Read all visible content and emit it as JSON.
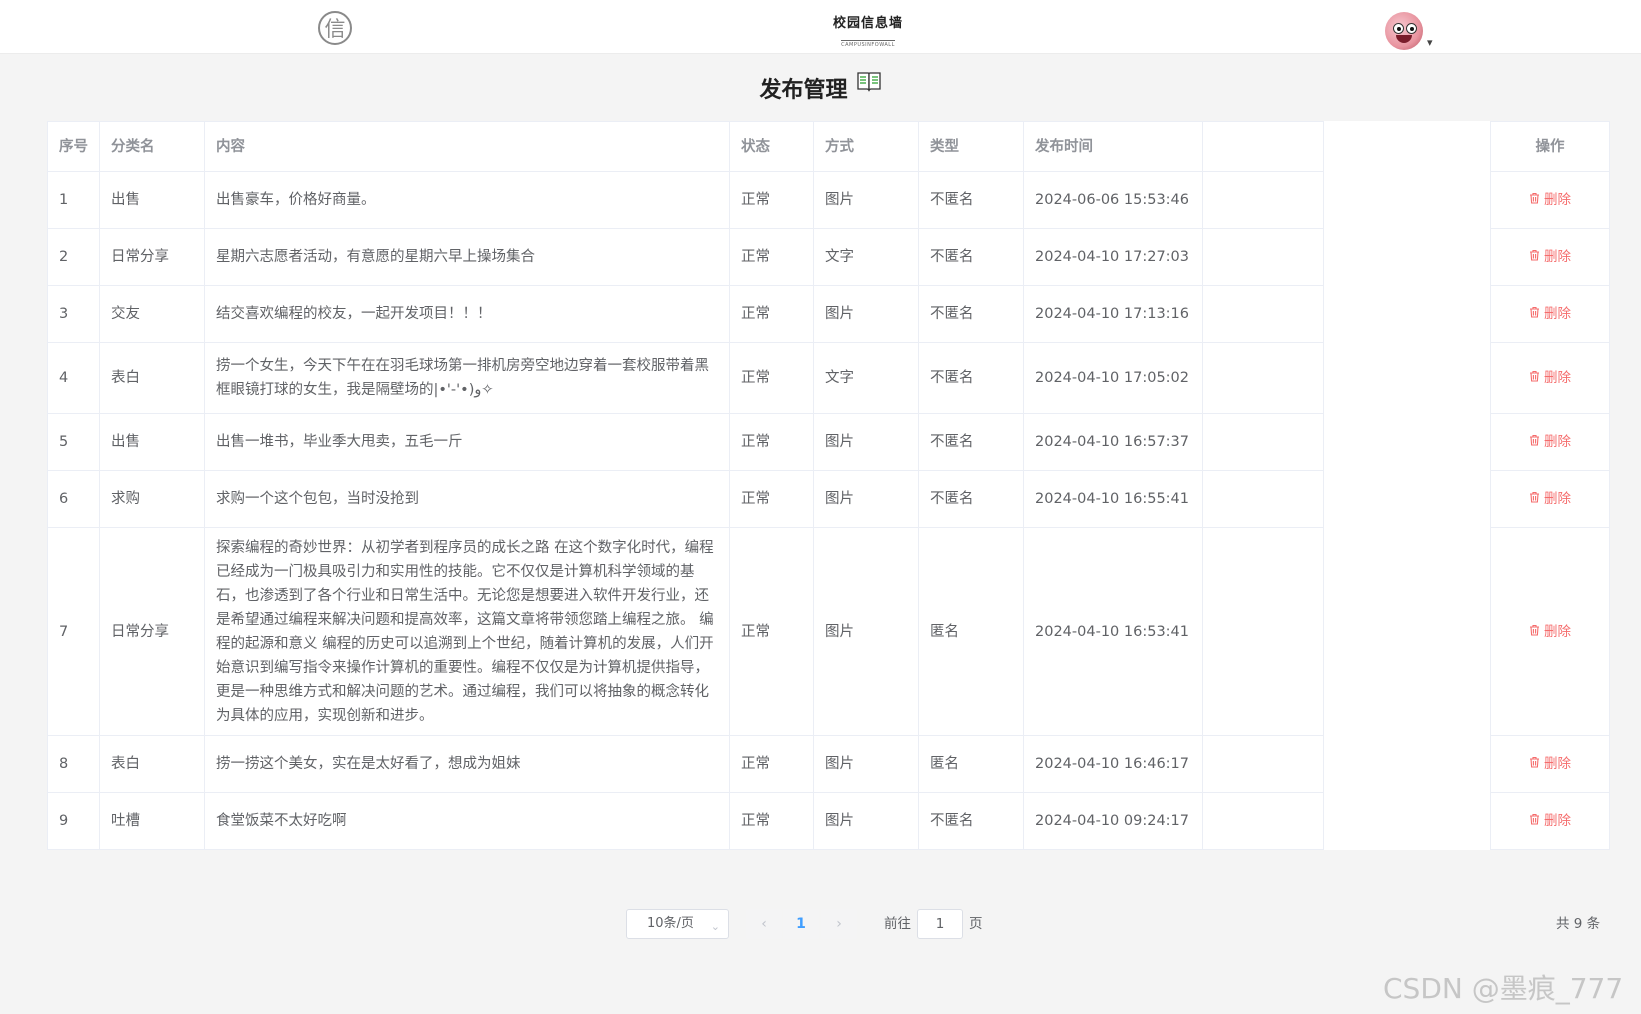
{
  "header": {
    "logo_glyph": "信",
    "brand_title": "校园信息墙",
    "brand_subtitle": "CAMPUSINFOWALL",
    "avatar_icon": "pig-avatar-icon",
    "user_menu_caret": "▾"
  },
  "page": {
    "title": "发布管理",
    "title_icon": "open-book-icon"
  },
  "table": {
    "columns": {
      "index": "序号",
      "category": "分类名",
      "content": "内容",
      "status": "状态",
      "mode": "方式",
      "type": "类型",
      "time": "发布时间",
      "extra": "",
      "actions": "操作"
    },
    "delete_label": "删除",
    "delete_icon": "trash-icon",
    "delete_color": "#f56c6c",
    "rows": [
      {
        "index": "1",
        "category": "出售",
        "content": "出售豪车，价格好商量。",
        "status": "正常",
        "mode": "图片",
        "type": "不匿名",
        "time": "2024-06-06 15:53:46"
      },
      {
        "index": "2",
        "category": "日常分享",
        "content": "星期六志愿者活动，有意愿的星期六早上操场集合",
        "status": "正常",
        "mode": "文字",
        "type": "不匿名",
        "time": "2024-04-10 17:27:03"
      },
      {
        "index": "3",
        "category": "交友",
        "content": "结交喜欢编程的校友，一起开发项目！！！",
        "status": "正常",
        "mode": "图片",
        "type": "不匿名",
        "time": "2024-04-10 17:13:16"
      },
      {
        "index": "4",
        "category": "表白",
        "content": "捞一个女生，今天下午在在羽毛球场第一排机房旁空地边穿着一套校服带着黑框眼镜打球的女生，我是隔壁场的|•'-'•)و✧",
        "status": "正常",
        "mode": "文字",
        "type": "不匿名",
        "time": "2024-04-10 17:05:02"
      },
      {
        "index": "5",
        "category": "出售",
        "content": "出售一堆书，毕业季大甩卖，五毛一斤",
        "status": "正常",
        "mode": "图片",
        "type": "不匿名",
        "time": "2024-04-10 16:57:37"
      },
      {
        "index": "6",
        "category": "求购",
        "content": "求购一个这个包包，当时没抢到",
        "status": "正常",
        "mode": "图片",
        "type": "不匿名",
        "time": "2024-04-10 16:55:41"
      },
      {
        "index": "7",
        "category": "日常分享",
        "content": "探索编程的奇妙世界：从初学者到程序员的成长之路 在这个数字化时代，编程已经成为一门极具吸引力和实用性的技能。它不仅仅是计算机科学领域的基石，也渗透到了各个行业和日常生活中。无论您是想要进入软件开发行业，还是希望通过编程来解决问题和提高效率，这篇文章将带领您踏上编程之旅。 编程的起源和意义 编程的历史可以追溯到上个世纪，随着计算机的发展，人们开始意识到编写指令来操作计算机的重要性。编程不仅仅是为计算机提供指导，更是一种思维方式和解决问题的艺术。通过编程，我们可以将抽象的概念转化为具体的应用，实现创新和进步。",
        "status": "正常",
        "mode": "图片",
        "type": "匿名",
        "time": "2024-04-10 16:53:41"
      },
      {
        "index": "8",
        "category": "表白",
        "content": "捞一捞这个美女，实在是太好看了，想成为姐妹",
        "status": "正常",
        "mode": "图片",
        "type": "匿名",
        "time": "2024-04-10 16:46:17"
      },
      {
        "index": "9",
        "category": "吐槽",
        "content": "食堂饭菜不太好吃啊",
        "status": "正常",
        "mode": "图片",
        "type": "不匿名",
        "time": "2024-04-10 09:24:17"
      }
    ]
  },
  "pagination": {
    "page_size_label": "10条/页",
    "prev_icon": "‹",
    "next_icon": "›",
    "current_page": "1",
    "goto_prefix": "前往",
    "goto_value": "1",
    "goto_suffix": "页",
    "total_label": "共 9 条",
    "active_color": "#409eff"
  },
  "watermark": "CSDN @墨痕_777"
}
